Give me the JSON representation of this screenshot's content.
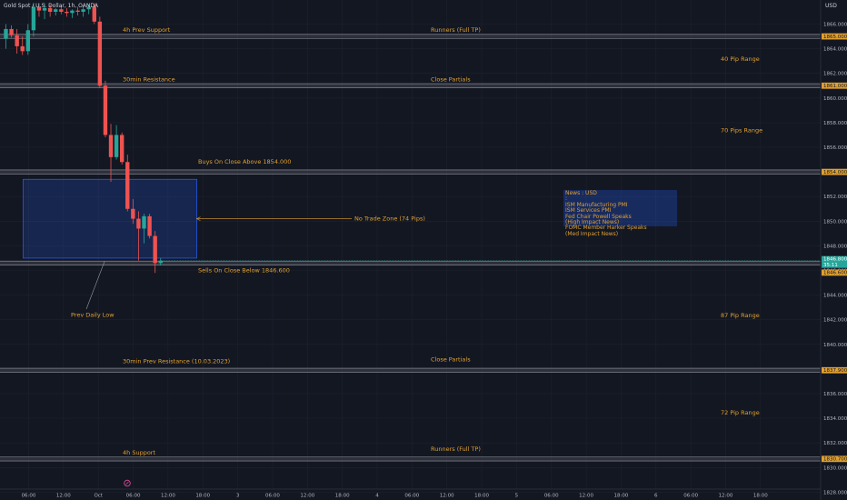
{
  "window": {
    "title": "Gold Spot / U.S. Dollar, 1h, OANDA",
    "currency": "USD"
  },
  "colors": {
    "up": "#26a69a",
    "down": "#ef5350",
    "accent": "#e0a030",
    "zone": "#2962ff",
    "background": "#131722"
  },
  "news": {
    "header": "News : USD :",
    "items": [
      "ISM Manufacturing PMI",
      "ISM Services PMI",
      "Fed Chair Powell Speaks",
      "(High Impact News)",
      "FOMC Member Harker Speaks",
      "(Med Impact News)"
    ]
  },
  "price_tags": {
    "last": "1846.800",
    "countdown": "35:11",
    "levels": [
      "1865.000",
      "1861.000",
      "1854.000",
      "1846.600",
      "1837.900",
      "1830.700"
    ]
  },
  "icons": {
    "event": "tradingview-event-icon"
  },
  "chart_data": {
    "type": "candlestick",
    "ylim": [
      1827.6,
      1867.7
    ],
    "y_ticks": [
      1866,
      1864,
      1862,
      1860,
      1858,
      1856,
      1854,
      1852,
      1850,
      1848,
      1846,
      1844,
      1842,
      1840,
      1838,
      1836,
      1834,
      1832,
      1830,
      1828
    ],
    "x_ticks": [
      "06:00",
      "12:00",
      "Oct",
      "06:00",
      "12:00",
      "18:00",
      "3",
      "06:00",
      "12:00",
      "18:00",
      "4",
      "06:00",
      "12:00",
      "18:00",
      "5",
      "06:00",
      "12:00",
      "18:00",
      "6",
      "06:00",
      "12:00",
      "18:00"
    ],
    "candles": [
      {
        "o": 1864.8,
        "h": 1866.0,
        "l": 1864.0,
        "c": 1865.6
      },
      {
        "o": 1865.6,
        "h": 1865.9,
        "l": 1864.9,
        "c": 1865.1
      },
      {
        "o": 1865.1,
        "h": 1865.6,
        "l": 1863.6,
        "c": 1864.2
      },
      {
        "o": 1864.2,
        "h": 1865.0,
        "l": 1863.5,
        "c": 1863.8
      },
      {
        "o": 1863.8,
        "h": 1866.0,
        "l": 1863.5,
        "c": 1865.5
      },
      {
        "o": 1865.5,
        "h": 1867.7,
        "l": 1865.0,
        "c": 1867.4
      },
      {
        "o": 1867.4,
        "h": 1867.7,
        "l": 1866.6,
        "c": 1867.1
      },
      {
        "o": 1867.1,
        "h": 1867.7,
        "l": 1866.4,
        "c": 1867.3
      },
      {
        "o": 1867.3,
        "h": 1867.6,
        "l": 1866.6,
        "c": 1867.0
      },
      {
        "o": 1867.0,
        "h": 1867.3,
        "l": 1866.7,
        "c": 1867.2
      },
      {
        "o": 1867.2,
        "h": 1867.5,
        "l": 1866.8,
        "c": 1867.0
      },
      {
        "o": 1867.0,
        "h": 1867.3,
        "l": 1866.6,
        "c": 1866.9
      },
      {
        "o": 1866.9,
        "h": 1867.2,
        "l": 1866.5,
        "c": 1867.1
      },
      {
        "o": 1867.1,
        "h": 1867.4,
        "l": 1866.7,
        "c": 1867.0
      },
      {
        "o": 1867.0,
        "h": 1867.5,
        "l": 1866.6,
        "c": 1867.2
      },
      {
        "o": 1867.2,
        "h": 1867.6,
        "l": 1866.8,
        "c": 1867.4
      },
      {
        "o": 1867.4,
        "h": 1867.7,
        "l": 1866.0,
        "c": 1866.2
      },
      {
        "o": 1866.2,
        "h": 1866.6,
        "l": 1860.8,
        "c": 1861.0
      },
      {
        "o": 1861.0,
        "h": 1861.4,
        "l": 1856.8,
        "c": 1857.0
      },
      {
        "o": 1857.0,
        "h": 1857.9,
        "l": 1853.2,
        "c": 1855.2
      },
      {
        "o": 1855.2,
        "h": 1857.8,
        "l": 1855.0,
        "c": 1857.0
      },
      {
        "o": 1857.0,
        "h": 1857.2,
        "l": 1854.6,
        "c": 1854.8
      },
      {
        "o": 1854.8,
        "h": 1855.4,
        "l": 1850.8,
        "c": 1851.0
      },
      {
        "o": 1851.0,
        "h": 1851.8,
        "l": 1849.8,
        "c": 1850.2
      },
      {
        "o": 1850.2,
        "h": 1850.8,
        "l": 1846.8,
        "c": 1849.4
      },
      {
        "o": 1849.4,
        "h": 1850.6,
        "l": 1848.2,
        "c": 1850.4
      },
      {
        "o": 1850.4,
        "h": 1850.6,
        "l": 1848.6,
        "c": 1848.8
      },
      {
        "o": 1848.8,
        "h": 1849.2,
        "l": 1845.8,
        "c": 1846.6
      },
      {
        "o": 1846.6,
        "h": 1847.0,
        "l": 1846.4,
        "c": 1846.8
      }
    ],
    "levels": [
      {
        "price": 1865.0,
        "left": "4h Prev Support",
        "right": "Runners (Full TP)"
      },
      {
        "price": 1861.0,
        "left": "30min Resistance",
        "right": "Close Partials"
      },
      {
        "price": 1854.0,
        "left": "Buys On Close Above 1854.000",
        "right": ""
      },
      {
        "price": 1846.6,
        "left": "Sells On Close Below 1846.600",
        "right": ""
      },
      {
        "price": 1837.9,
        "left": "30min Prev Resistance (10.03.2023)",
        "right": "Close Partials"
      },
      {
        "price": 1830.7,
        "left": "4h Support",
        "right": "Runners (Full TP)"
      }
    ],
    "range_labels": [
      {
        "price": 1863.0,
        "text": "40 Pip Range"
      },
      {
        "price": 1857.2,
        "text": "70 Pips Range"
      },
      {
        "price": 1842.2,
        "text": "87 Pip Range"
      },
      {
        "price": 1834.3,
        "text": "72 Pip Range"
      }
    ],
    "zone": {
      "top": 1853.4,
      "bottom": 1847.0,
      "label": "No Trade Zone (74 Pips)"
    },
    "annotations": [
      {
        "text": "Prev Daily Low",
        "price": 1846.8
      }
    ]
  }
}
